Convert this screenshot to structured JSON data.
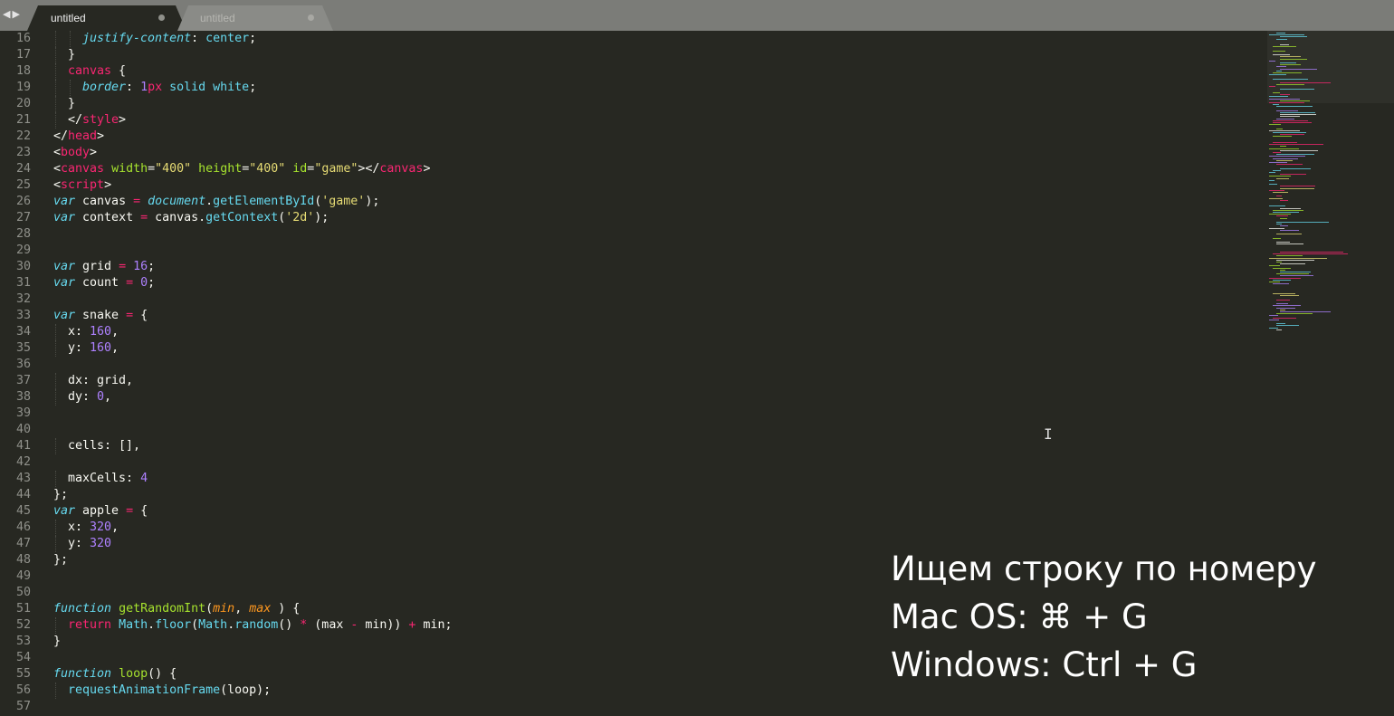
{
  "tabs": [
    {
      "label": "untitled",
      "active": true,
      "modified": true
    },
    {
      "label": "untitled",
      "active": false,
      "modified": true
    }
  ],
  "nav": {
    "back_glyph": "◀",
    "forward_glyph": "▶"
  },
  "colors": {
    "background": "#272822",
    "tabbar": "#7b7c78",
    "keyword": "#66d9ef",
    "tag": "#f92672",
    "attribute": "#a6e22e",
    "string": "#e6db74",
    "number": "#ae81ff",
    "param": "#fd971f",
    "text": "#f8f8f2",
    "gutter": "#8f908a"
  },
  "lines": [
    {
      "n": "16",
      "indent": 4,
      "t": [
        [
          "pr",
          "justify-content"
        ],
        [
          "",
          ""
        ],
        [
          "",
          ": "
        ],
        [
          "v",
          "center"
        ],
        [
          "",
          ";"
        ]
      ]
    },
    {
      "n": "17",
      "indent": 2,
      "t": [
        [
          "",
          "}"
        ]
      ]
    },
    {
      "n": "18",
      "indent": 2,
      "t": [
        [
          "t",
          "canvas"
        ],
        [
          "",
          " {"
        ]
      ]
    },
    {
      "n": "19",
      "indent": 4,
      "t": [
        [
          "pr",
          "border"
        ],
        [
          "",
          ": "
        ],
        [
          "n",
          "1"
        ],
        [
          "t",
          "px"
        ],
        [
          "",
          " "
        ],
        [
          "v",
          "solid"
        ],
        [
          "",
          " "
        ],
        [
          "v",
          "white"
        ],
        [
          "",
          ";"
        ]
      ]
    },
    {
      "n": "20",
      "indent": 2,
      "t": [
        [
          "",
          "}"
        ]
      ]
    },
    {
      "n": "21",
      "indent": 2,
      "t": [
        [
          "",
          "</"
        ],
        [
          "t",
          "style"
        ],
        [
          "",
          ">"
        ]
      ]
    },
    {
      "n": "22",
      "indent": 0,
      "t": [
        [
          "",
          "</"
        ],
        [
          "t",
          "head"
        ],
        [
          "",
          ">"
        ]
      ]
    },
    {
      "n": "23",
      "indent": 0,
      "t": [
        [
          "",
          "<"
        ],
        [
          "t",
          "body"
        ],
        [
          "",
          ">"
        ]
      ]
    },
    {
      "n": "24",
      "indent": 0,
      "t": [
        [
          "",
          "<"
        ],
        [
          "t",
          "canvas"
        ],
        [
          "",
          " "
        ],
        [
          "a",
          "width"
        ],
        [
          "",
          "="
        ],
        [
          "s",
          "\"400\""
        ],
        [
          "",
          " "
        ],
        [
          "a",
          "height"
        ],
        [
          "",
          "="
        ],
        [
          "s",
          "\"400\""
        ],
        [
          "",
          " "
        ],
        [
          "a",
          "id"
        ],
        [
          "",
          "="
        ],
        [
          "s",
          "\"game\""
        ],
        [
          "",
          "></"
        ],
        [
          "t",
          "canvas"
        ],
        [
          "",
          ">"
        ]
      ]
    },
    {
      "n": "25",
      "indent": 0,
      "t": [
        [
          "",
          "<"
        ],
        [
          "t",
          "script"
        ],
        [
          "",
          ">"
        ]
      ]
    },
    {
      "n": "26",
      "indent": 0,
      "t": [
        [
          "k",
          "var"
        ],
        [
          "",
          " canvas "
        ],
        [
          "o",
          "="
        ],
        [
          "",
          " "
        ],
        [
          "pr",
          "document"
        ],
        [
          "",
          "."
        ],
        [
          "sup",
          "getElementById"
        ],
        [
          "",
          "("
        ],
        [
          "s",
          "'game'"
        ],
        [
          "",
          ");"
        ]
      ]
    },
    {
      "n": "27",
      "indent": 0,
      "t": [
        [
          "k",
          "var"
        ],
        [
          "",
          " context "
        ],
        [
          "o",
          "="
        ],
        [
          "",
          " canvas."
        ],
        [
          "sup",
          "getContext"
        ],
        [
          "",
          "("
        ],
        [
          "s",
          "'2d'"
        ],
        [
          "",
          ");"
        ]
      ]
    },
    {
      "n": "28",
      "indent": 0,
      "t": []
    },
    {
      "n": "29",
      "indent": 0,
      "t": []
    },
    {
      "n": "30",
      "indent": 0,
      "t": [
        [
          "k",
          "var"
        ],
        [
          "",
          " grid "
        ],
        [
          "o",
          "="
        ],
        [
          "",
          " "
        ],
        [
          "n",
          "16"
        ],
        [
          "",
          ";"
        ]
      ]
    },
    {
      "n": "31",
      "indent": 0,
      "t": [
        [
          "k",
          "var"
        ],
        [
          "",
          " count "
        ],
        [
          "o",
          "="
        ],
        [
          "",
          " "
        ],
        [
          "n",
          "0"
        ],
        [
          "",
          ";"
        ]
      ]
    },
    {
      "n": "32",
      "indent": 0,
      "t": []
    },
    {
      "n": "33",
      "indent": 0,
      "t": [
        [
          "k",
          "var"
        ],
        [
          "",
          " snake "
        ],
        [
          "o",
          "="
        ],
        [
          "",
          " {"
        ]
      ]
    },
    {
      "n": "34",
      "indent": 2,
      "t": [
        [
          "",
          "x: "
        ],
        [
          "n",
          "160"
        ],
        [
          "",
          ","
        ]
      ]
    },
    {
      "n": "35",
      "indent": 2,
      "t": [
        [
          "",
          "y: "
        ],
        [
          "n",
          "160"
        ],
        [
          "",
          ","
        ]
      ]
    },
    {
      "n": "36",
      "indent": 0,
      "t": []
    },
    {
      "n": "37",
      "indent": 2,
      "t": [
        [
          "",
          "dx: grid,"
        ]
      ]
    },
    {
      "n": "38",
      "indent": 2,
      "t": [
        [
          "",
          "dy: "
        ],
        [
          "n",
          "0"
        ],
        [
          "",
          ","
        ]
      ]
    },
    {
      "n": "39",
      "indent": 0,
      "t": []
    },
    {
      "n": "40",
      "indent": 0,
      "t": []
    },
    {
      "n": "41",
      "indent": 2,
      "t": [
        [
          "",
          "cells: [],"
        ]
      ]
    },
    {
      "n": "42",
      "indent": 0,
      "t": []
    },
    {
      "n": "43",
      "indent": 2,
      "t": [
        [
          "",
          "maxCells: "
        ],
        [
          "n",
          "4"
        ]
      ]
    },
    {
      "n": "44",
      "indent": 0,
      "t": [
        [
          "",
          "};"
        ]
      ]
    },
    {
      "n": "45",
      "indent": 0,
      "t": [
        [
          "k",
          "var"
        ],
        [
          "",
          " apple "
        ],
        [
          "o",
          "="
        ],
        [
          "",
          " {"
        ]
      ]
    },
    {
      "n": "46",
      "indent": 2,
      "t": [
        [
          "",
          "x: "
        ],
        [
          "n",
          "320"
        ],
        [
          "",
          ","
        ]
      ]
    },
    {
      "n": "47",
      "indent": 2,
      "t": [
        [
          "",
          "y: "
        ],
        [
          "n",
          "320"
        ]
      ]
    },
    {
      "n": "48",
      "indent": 0,
      "t": [
        [
          "",
          "};"
        ]
      ]
    },
    {
      "n": "49",
      "indent": 0,
      "t": []
    },
    {
      "n": "50",
      "indent": 0,
      "t": []
    },
    {
      "n": "51",
      "indent": 0,
      "t": [
        [
          "k",
          "function"
        ],
        [
          "",
          " "
        ],
        [
          "f",
          "getRandomInt"
        ],
        [
          "",
          "("
        ],
        [
          "p",
          "min"
        ],
        [
          "",
          ", "
        ],
        [
          "p",
          "max"
        ],
        [
          "",
          " ) {"
        ]
      ]
    },
    {
      "n": "52",
      "indent": 2,
      "t": [
        [
          "t",
          "return"
        ],
        [
          "",
          " "
        ],
        [
          "sup",
          "Math"
        ],
        [
          "",
          "."
        ],
        [
          "sup",
          "floor"
        ],
        [
          "",
          "("
        ],
        [
          "sup",
          "Math"
        ],
        [
          "",
          "."
        ],
        [
          "sup",
          "random"
        ],
        [
          "",
          "() "
        ],
        [
          "o",
          "*"
        ],
        [
          "",
          " (max "
        ],
        [
          "o",
          "-"
        ],
        [
          "",
          " min)) "
        ],
        [
          "o",
          "+"
        ],
        [
          "",
          " min;"
        ]
      ]
    },
    {
      "n": "53",
      "indent": 0,
      "t": [
        [
          "",
          "}"
        ]
      ]
    },
    {
      "n": "54",
      "indent": 0,
      "t": []
    },
    {
      "n": "55",
      "indent": 0,
      "t": [
        [
          "k",
          "function"
        ],
        [
          "",
          " "
        ],
        [
          "f",
          "loop"
        ],
        [
          "",
          "() {"
        ]
      ]
    },
    {
      "n": "56",
      "indent": 2,
      "t": [
        [
          "sup",
          "requestAnimationFrame"
        ],
        [
          "",
          "(loop);"
        ]
      ]
    },
    {
      "n": "57",
      "indent": 0,
      "t": []
    }
  ],
  "caption": {
    "line1": "Ищем строку по номеру",
    "line2": "Mac OS: ⌘ + G",
    "line3": "Windows: Ctrl + G"
  },
  "cursor_glyph": "I"
}
